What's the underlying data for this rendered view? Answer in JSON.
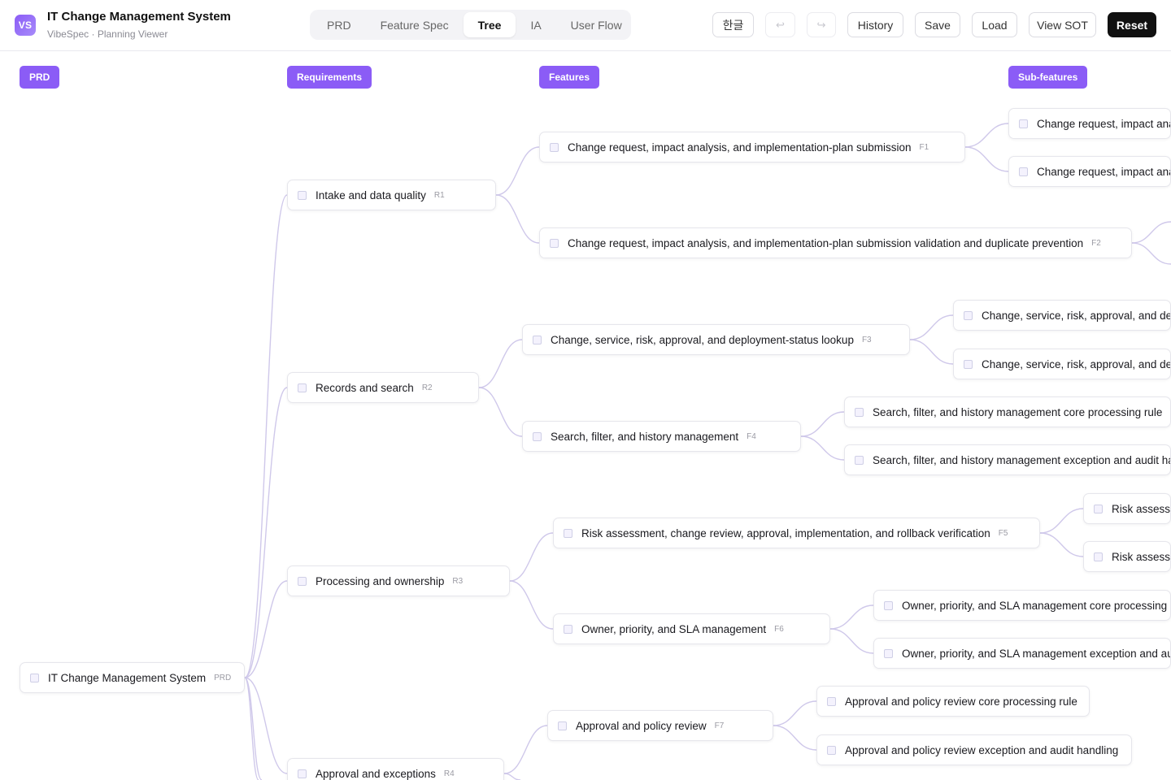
{
  "app": {
    "logo": "VS",
    "title": "IT Change Management System",
    "subtitle": "VibeSpec · Planning Viewer"
  },
  "tabs": [
    {
      "label": "PRD",
      "active": false
    },
    {
      "label": "Feature Spec",
      "active": false
    },
    {
      "label": "Tree",
      "active": true
    },
    {
      "label": "IA",
      "active": false
    },
    {
      "label": "User Flow",
      "active": false
    }
  ],
  "toolbar": {
    "lang_label": "한글",
    "undo_icon": "↩",
    "redo_icon": "↪",
    "history_label": "History",
    "save_label": "Save",
    "load_label": "Load",
    "view_sot_label": "View SOT",
    "reset_label": "Reset"
  },
  "columns": {
    "prd": "PRD",
    "requirements": "Requirements",
    "features": "Features",
    "subfeatures": "Sub-features"
  },
  "colors": {
    "accent": "#8b5cf6",
    "link": "#cfc8ea"
  },
  "tree": {
    "root": {
      "label": "IT Change Management System",
      "tag": "PRD"
    },
    "requirements": [
      {
        "label": "Intake and data quality",
        "tag": "R1"
      },
      {
        "label": "Records and search",
        "tag": "R2"
      },
      {
        "label": "Processing and ownership",
        "tag": "R3"
      },
      {
        "label": "Approval and exceptions",
        "tag": "R4"
      }
    ],
    "features": [
      {
        "label": "Change request, impact analysis, and implementation-plan submission",
        "tag": "F1"
      },
      {
        "label": "Change request, impact analysis, and implementation-plan submission validation and duplicate prevention",
        "tag": "F2"
      },
      {
        "label": "Change, service, risk, approval, and deployment-status lookup",
        "tag": "F3"
      },
      {
        "label": "Search, filter, and history management",
        "tag": "F4"
      },
      {
        "label": "Risk assessment, change review, approval, implementation, and rollback verification",
        "tag": "F5"
      },
      {
        "label": "Owner, priority, and SLA management",
        "tag": "F6"
      },
      {
        "label": "Approval and policy review",
        "tag": "F7"
      }
    ],
    "subfeatures": [
      {
        "label": "Change request, impact analy"
      },
      {
        "label": "Change request, impact analy"
      },
      {
        "label": "Change, service, risk, approval, and deplo"
      },
      {
        "label": "Change, service, risk, approval, and deplo"
      },
      {
        "label": "Search, filter, and history management core processing rule"
      },
      {
        "label": "Search, filter, and history management exception and audit hand"
      },
      {
        "label": "Risk assessme"
      },
      {
        "label": "Risk assessme"
      },
      {
        "label": "Owner, priority, and SLA management core processing rule"
      },
      {
        "label": "Owner, priority, and SLA management exception and audit"
      },
      {
        "label": "Approval and policy review core processing rule"
      },
      {
        "label": "Approval and policy review exception and audit handling"
      }
    ]
  }
}
